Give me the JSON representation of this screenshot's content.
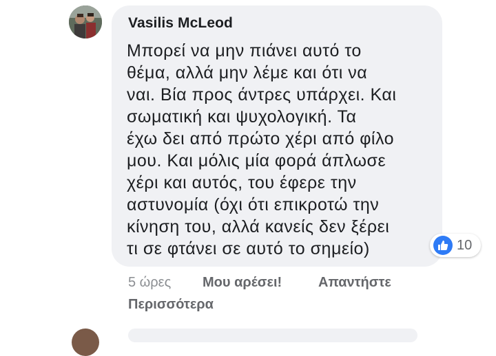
{
  "comment": {
    "author": "Vasilis McLeod",
    "lines": [
      "Μπορεί να μην πιάνει αυτό το",
      "θέμα, αλλά μην λέμε και ότι να",
      "ναι. Βία προς άντρες υπάρχει. Και",
      "σωματική και ψυχολογική. Τα",
      "έχω δει από πρώτο χέρι από φίλο",
      "μου. Και μόλις μία φορά άπλωσε",
      "χέρι και αυτός, του έφερε την",
      "αστυνομία (όχι ότι επικροτώ την",
      "κίνηση του, αλλά κανείς δεν ξέρει",
      "τι σε φτάνει σε αυτό το σημείο)"
    ],
    "reaction_count": "10",
    "reaction_icon": "thumbs-up-icon",
    "time": "5 ώρες",
    "like_label": "Μου αρέσει!",
    "reply_label": "Απαντήστε",
    "more_label": "Περισσότερα"
  },
  "colors": {
    "bubble": "#f0f1f4",
    "like_blue": "#2e7bf6",
    "secondary_text": "#65676b"
  }
}
